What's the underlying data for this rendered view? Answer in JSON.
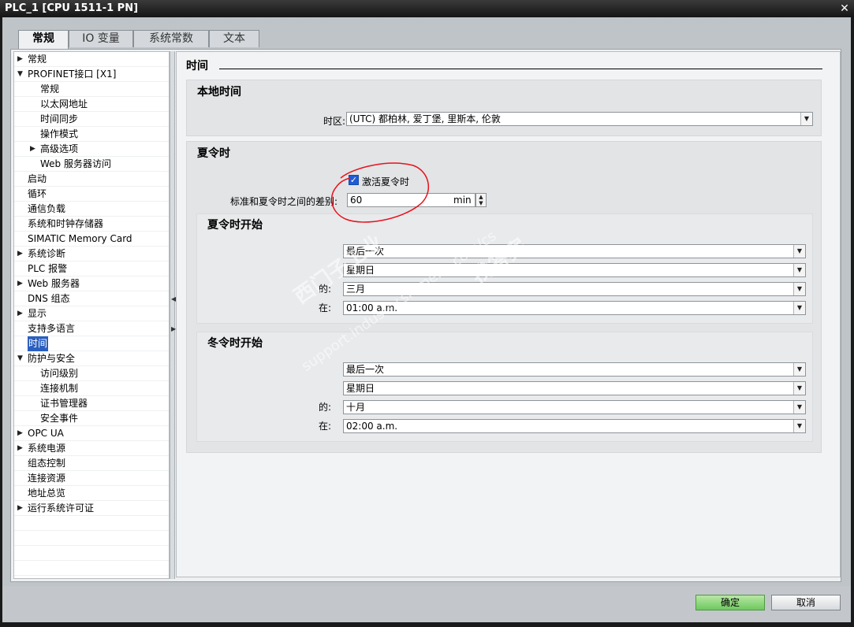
{
  "window": {
    "title": "PLC_1 [CPU 1511-1 PN]",
    "close": "✕"
  },
  "tabs": [
    "常规",
    "IO 变量",
    "系统常数",
    "文本"
  ],
  "tree": [
    {
      "label": "常规",
      "level": 0,
      "arrow": "right"
    },
    {
      "label": "PROFINET接口 [X1]",
      "level": 0,
      "arrow": "down"
    },
    {
      "label": "常规",
      "level": 1,
      "arrow": ""
    },
    {
      "label": "以太网地址",
      "level": 1,
      "arrow": ""
    },
    {
      "label": "时间同步",
      "level": 1,
      "arrow": ""
    },
    {
      "label": "操作模式",
      "level": 1,
      "arrow": ""
    },
    {
      "label": "高级选项",
      "level": 1,
      "arrow": "right"
    },
    {
      "label": "Web 服务器访问",
      "level": 1,
      "arrow": ""
    },
    {
      "label": "启动",
      "level": 0,
      "arrow": ""
    },
    {
      "label": "循环",
      "level": 0,
      "arrow": ""
    },
    {
      "label": "通信负载",
      "level": 0,
      "arrow": ""
    },
    {
      "label": "系统和时钟存储器",
      "level": 0,
      "arrow": ""
    },
    {
      "label": "SIMATIC Memory Card",
      "level": 0,
      "arrow": ""
    },
    {
      "label": "系统诊断",
      "level": 0,
      "arrow": "right"
    },
    {
      "label": "PLC 报警",
      "level": 0,
      "arrow": ""
    },
    {
      "label": "Web 服务器",
      "level": 0,
      "arrow": "right"
    },
    {
      "label": "DNS 组态",
      "level": 0,
      "arrow": ""
    },
    {
      "label": "显示",
      "level": 0,
      "arrow": "right"
    },
    {
      "label": "支持多语言",
      "level": 0,
      "arrow": ""
    },
    {
      "label": "时间",
      "level": 0,
      "arrow": "",
      "selected": true
    },
    {
      "label": "防护与安全",
      "level": 0,
      "arrow": "down"
    },
    {
      "label": "访问级别",
      "level": 1,
      "arrow": ""
    },
    {
      "label": "连接机制",
      "level": 1,
      "arrow": ""
    },
    {
      "label": "证书管理器",
      "level": 1,
      "arrow": ""
    },
    {
      "label": "安全事件",
      "level": 1,
      "arrow": ""
    },
    {
      "label": "OPC UA",
      "level": 0,
      "arrow": "right"
    },
    {
      "label": "系统电源",
      "level": 0,
      "arrow": "right"
    },
    {
      "label": "组态控制",
      "level": 0,
      "arrow": ""
    },
    {
      "label": "连接资源",
      "level": 0,
      "arrow": ""
    },
    {
      "label": "地址总览",
      "level": 0,
      "arrow": ""
    },
    {
      "label": "运行系统许可证",
      "level": 0,
      "arrow": "right"
    }
  ],
  "content": {
    "section_title": "时间",
    "local_time": {
      "title": "本地时间",
      "tz_label": "时区:",
      "tz_value": "(UTC) 都柏林, 爱丁堡, 里斯本, 伦敦"
    },
    "dst": {
      "title": "夏令时",
      "activate_label": "激活夏令时",
      "activate_checked": true,
      "diff_label": "标准和夏令时之间的差别:",
      "diff_value": "60",
      "diff_unit": "min",
      "start": {
        "title": "夏令时开始",
        "week": "最后一次",
        "day": "星期日",
        "month_label": "的:",
        "month": "三月",
        "time_label": "在:",
        "time": "01:00 a.m."
      },
      "end": {
        "title": "冬令时开始",
        "week": "最后一次",
        "day": "星期日",
        "month_label": "的:",
        "month": "十月",
        "time_label": "在:",
        "time": "02:00 a.m."
      }
    }
  },
  "buttons": {
    "ok": "确定",
    "cancel": "取消"
  },
  "watermark": {
    "line1": "西门子工业",
    "line2": "support.industry.siemens.com/cs",
    "line3": "找答案"
  },
  "annotation_color": "#e8121c"
}
